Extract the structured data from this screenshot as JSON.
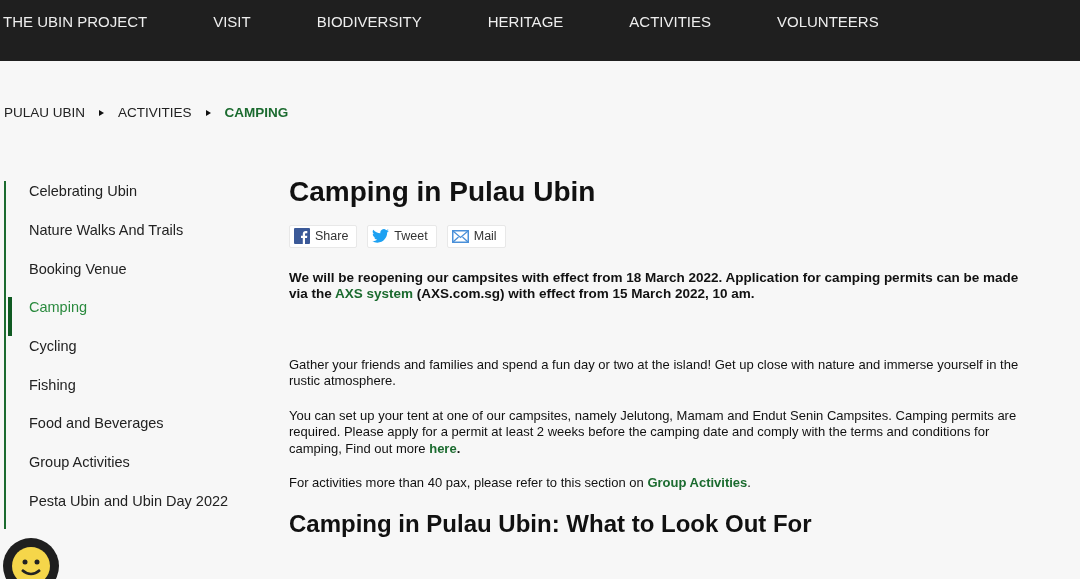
{
  "nav": {
    "items": [
      {
        "label": "THE UBIN PROJECT"
      },
      {
        "label": "VISIT"
      },
      {
        "label": "BIODIVERSITY"
      },
      {
        "label": "HERITAGE"
      },
      {
        "label": "ACTIVITIES"
      },
      {
        "label": "VOLUNTEERS"
      }
    ]
  },
  "breadcrumb": [
    {
      "label": "PULAU UBIN",
      "current": false
    },
    {
      "label": "ACTIVITIES",
      "current": false
    },
    {
      "label": "CAMPING",
      "current": true
    }
  ],
  "sidebar": {
    "items": [
      {
        "label": "Celebrating Ubin",
        "selected": false
      },
      {
        "label": "Nature Walks And Trails",
        "selected": false
      },
      {
        "label": "Booking Venue",
        "selected": false
      },
      {
        "label": "Camping",
        "selected": true
      },
      {
        "label": "Cycling",
        "selected": false
      },
      {
        "label": "Fishing",
        "selected": false
      },
      {
        "label": "Food and Beverages",
        "selected": false
      },
      {
        "label": "Group Activities",
        "selected": false
      },
      {
        "label": "Pesta Ubin and Ubin Day 2022",
        "selected": false
      }
    ]
  },
  "main": {
    "title": "Camping in Pulau Ubin",
    "share_buttons": [
      {
        "kind": "facebook",
        "label": "Share"
      },
      {
        "kind": "twitter",
        "label": "Tweet"
      },
      {
        "kind": "mail",
        "label": "Mail"
      }
    ],
    "paragraphs": [
      {
        "kind": "notice",
        "segments": [
          {
            "kind": "text",
            "text": "We will be reopening our campsites with effect from 18 March 2022.  Application for camping permits can be made via the "
          },
          {
            "kind": "link",
            "text": "AXS system"
          },
          {
            "kind": "text",
            "text": " (AXS.com.sg) with effect from 15 March 2022, 10 am."
          }
        ]
      },
      {
        "kind": "body",
        "segments": [
          {
            "kind": "text",
            "text": "Gather your friends and families and spend a fun day or two at the island! Get up close with nature and immerse yourself in the rustic atmosphere."
          }
        ]
      },
      {
        "kind": "body",
        "segments": [
          {
            "kind": "text",
            "text": "You can set up your tent at one of our campsites, namely Jelutong, Mamam and Endut Senin Campsites. Camping permits are required. Please apply for a permit at least 2 weeks before the camping date and comply with the terms and conditions for camping, Find out more "
          },
          {
            "kind": "link",
            "text": "here"
          },
          {
            "kind": "strong",
            "text": "."
          }
        ]
      },
      {
        "kind": "body",
        "segments": [
          {
            "kind": "text",
            "text": "For activities more than 40 pax, please refer to this section on "
          },
          {
            "kind": "link",
            "text": "Group Activities"
          },
          {
            "kind": "text",
            "text": "."
          }
        ]
      }
    ],
    "subheading": "Camping in Pulau Ubin: What to Look Out For"
  }
}
